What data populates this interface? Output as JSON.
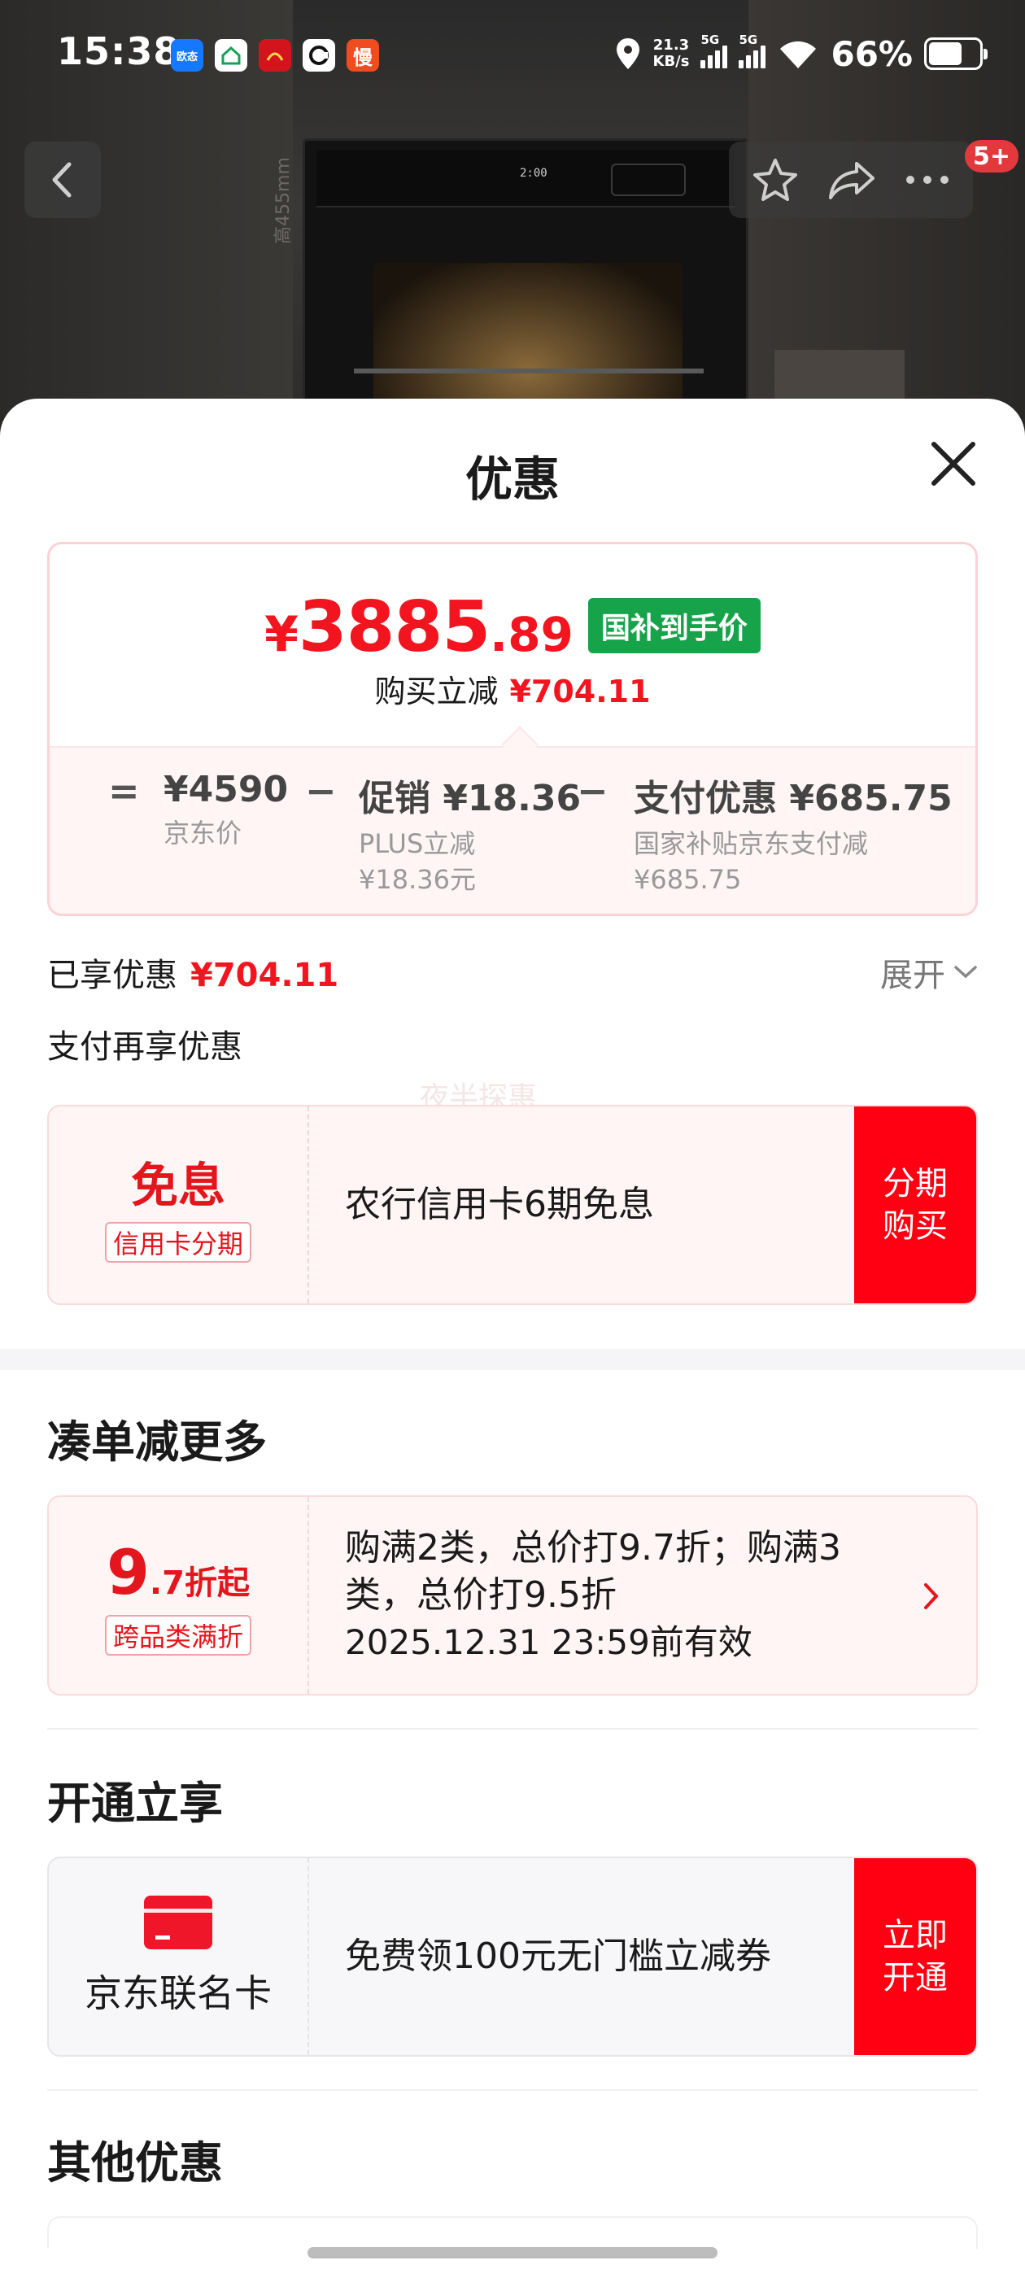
{
  "status_bar": {
    "time": "15:38",
    "apps": [
      "欧态",
      "",
      "",
      "",
      "慢"
    ],
    "net_speed_value": "21.3",
    "net_speed_unit": "KB/s",
    "sim1": "5G",
    "sim2": "5G",
    "battery": "66%",
    "battery_level": 0.66
  },
  "nav": {
    "badge": "5+"
  },
  "photo": {
    "oven_display": "2:00",
    "side_label": "高455mm"
  },
  "sheet": {
    "title": "优惠",
    "price": {
      "yen": "¥",
      "integer": "3885",
      "decimal": ".89",
      "tag": "国补到手价",
      "save_label": "购买立减",
      "save_amount": "¥704.11"
    },
    "formula": {
      "eq": "=",
      "minus": "−",
      "jd_price": "¥4590",
      "jd_price_label": "京东价",
      "promo": "促销 ¥18.36",
      "promo_sub1": "PLUS立减",
      "promo_sub2": "¥18.36元",
      "pay": "支付优惠 ¥685.75",
      "pay_sub1": "国家补贴京东支付减",
      "pay_sub2": "¥685.75"
    },
    "enjoyed_label": "已享优惠",
    "enjoyed_amount": "¥704.11",
    "expand": "展开",
    "pay_more": "支付再享优惠",
    "watermark": "夜半探惠",
    "installment": {
      "tag_big": "免息",
      "tag_small": "信用卡分期",
      "text": "农行信用卡6期免息",
      "cta_line1": "分期",
      "cta_line2": "购买"
    },
    "bundle_title": "凑单减更多",
    "bundle": {
      "discount_int": "9",
      "discount_rest": ".7折起",
      "tag_small": "跨品类满折",
      "line1": "购满2类，总价打9.7折；购满3",
      "line2": "类，总价打9.5折",
      "line3": "2025.12.31 23:59前有效"
    },
    "open_title": "开通立享",
    "card_offer": {
      "card_name": "京东联名卡",
      "text": "免费领100元无门槛立减券",
      "cta_line1": "立即",
      "cta_line2": "开通"
    },
    "other_title": "其他优惠"
  },
  "colors": {
    "price_red": "#f2141e",
    "gov_green": "#16a34a",
    "cta_red": "#fe0012"
  }
}
